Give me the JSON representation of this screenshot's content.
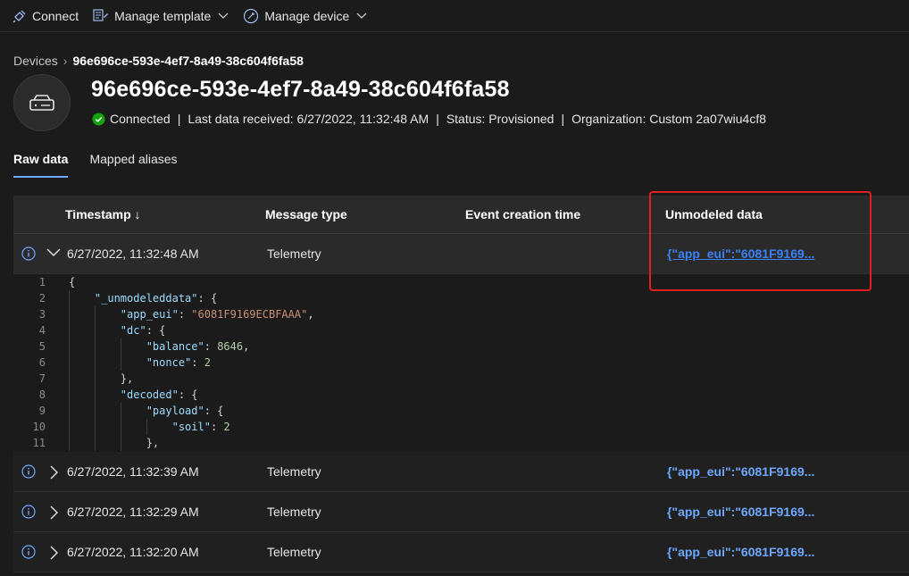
{
  "toolbar": {
    "connect": "Connect",
    "manage_template": "Manage template",
    "manage_device": "Manage device"
  },
  "breadcrumb": {
    "parent": "Devices",
    "current": "96e696ce-593e-4ef7-8a49-38c604f6fa58"
  },
  "device": {
    "title": "96e696ce-593e-4ef7-8a49-38c604f6fa58",
    "connection": "Connected",
    "last_data": "Last data received: 6/27/2022, 11:32:48 AM",
    "status": "Status: Provisioned",
    "organization": "Organization: Custom 2a07wiu4cf8"
  },
  "tabs": {
    "raw": "Raw data",
    "mapped": "Mapped aliases"
  },
  "grid": {
    "headers": {
      "timestamp": "Timestamp ↓",
      "message_type": "Message type",
      "event_creation": "Event creation time",
      "unmodeled": "Unmodeled data"
    },
    "rows": [
      {
        "timestamp": "6/27/2022, 11:32:48 AM",
        "message_type": "Telemetry",
        "unmodeled": "{\"app_eui\":\"6081F9169..."
      },
      {
        "timestamp": "6/27/2022, 11:32:39 AM",
        "message_type": "Telemetry",
        "unmodeled": "{\"app_eui\":\"6081F9169..."
      },
      {
        "timestamp": "6/27/2022, 11:32:29 AM",
        "message_type": "Telemetry",
        "unmodeled": "{\"app_eui\":\"6081F9169..."
      },
      {
        "timestamp": "6/27/2022, 11:32:20 AM",
        "message_type": "Telemetry",
        "unmodeled": "{\"app_eui\":\"6081F9169..."
      }
    ]
  },
  "json_lines": [
    {
      "n": "1",
      "text": "{"
    },
    {
      "n": "2",
      "text": "    \"_unmodeleddata\": {"
    },
    {
      "n": "3",
      "text": "        \"app_eui\": \"6081F9169ECBFAAA\","
    },
    {
      "n": "4",
      "text": "        \"dc\": {"
    },
    {
      "n": "5",
      "text": "            \"balance\": 8646,"
    },
    {
      "n": "6",
      "text": "            \"nonce\": 2"
    },
    {
      "n": "7",
      "text": "        },"
    },
    {
      "n": "8",
      "text": "        \"decoded\": {"
    },
    {
      "n": "9",
      "text": "            \"payload\": {"
    },
    {
      "n": "10",
      "text": "                \"soil\": 2"
    },
    {
      "n": "11",
      "text": "            },"
    }
  ],
  "colors": {
    "accent": "#6ea8ff",
    "link": "#3b82f6",
    "connected": "#13a10e",
    "highlight": "#e02020"
  }
}
